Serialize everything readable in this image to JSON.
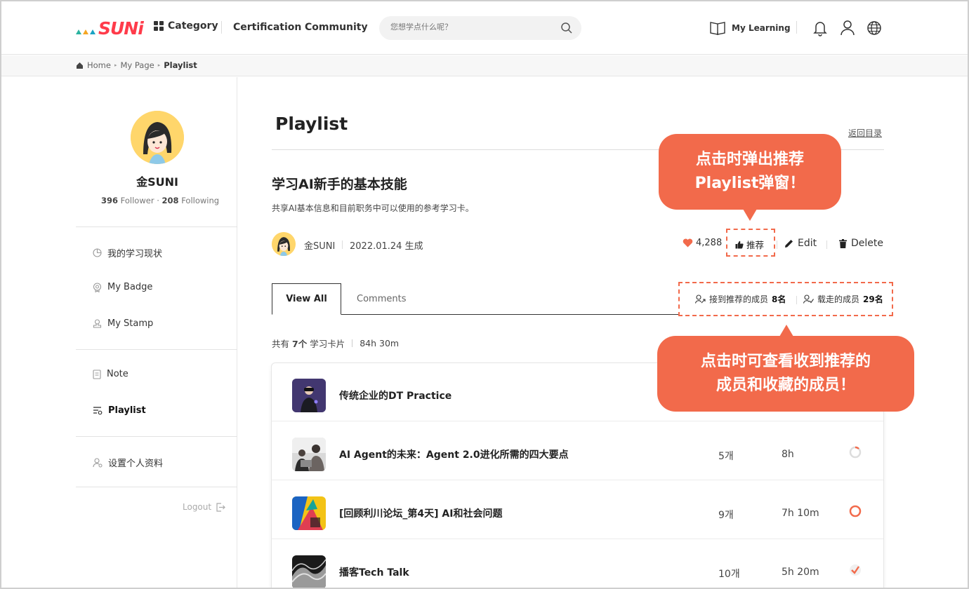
{
  "header": {
    "logo_text": "SUNi",
    "category_label": "Category",
    "certification_label": "Certification",
    "community_label": "Community",
    "search_placeholder": "您想学点什么呢？",
    "my_learning_label": "My Learning",
    "icons": [
      "bell-icon",
      "user-icon",
      "globe-icon"
    ]
  },
  "breadcrumb": {
    "home": "Home",
    "mypage": "My Page",
    "current": "Playlist"
  },
  "profile": {
    "name": "金SUNI",
    "followers": "396",
    "followers_label": "Follower",
    "following": "208",
    "following_label": "Following"
  },
  "sidebar": {
    "items": [
      {
        "label": "我的学习现状",
        "icon": "pie-chart-icon"
      },
      {
        "label": "My Badge",
        "icon": "badge-icon"
      },
      {
        "label": "My Stamp",
        "icon": "stamp-icon"
      },
      {
        "label": "Note",
        "icon": "note-icon"
      },
      {
        "label": "Playlist",
        "icon": "playlist-icon",
        "active": true
      },
      {
        "label": "设置个人资料",
        "icon": "profile-settings-icon"
      }
    ],
    "logout_label": "Logout"
  },
  "main": {
    "page_title": "Playlist",
    "back_link": "返回目录",
    "playlist_title": "学习AI新手的基本技能",
    "playlist_desc": "共享AI基本信息和目前职务中可以使用的参考学习卡。",
    "author": "金SUNI",
    "created": "2022.01.24 生成",
    "likes": "4,288",
    "recommend_label": "推荐",
    "edit_label": "Edit",
    "delete_label": "Delete",
    "tabs": {
      "view_all": "View All",
      "comments": "Comments"
    },
    "received_label": "接到推荐的成员",
    "received_count": "8名",
    "saved_label": "载走的成员",
    "saved_count": "29名",
    "count_prefix": "共有",
    "count_num": "7个",
    "count_suffix": "学习卡片",
    "total_time": "84h 30m"
  },
  "cards": [
    {
      "title": "传统企业的DT Practice",
      "count": "",
      "time": "",
      "status": ""
    },
    {
      "title": "AI Agent的未来：Agent 2.0进化所需的四大要点",
      "count": "5개",
      "time": "8h",
      "status": "partial"
    },
    {
      "title": "[回顾利川论坛_第4天] AI和社会问题",
      "count": "9개",
      "time": "7h 10m",
      "status": "in-progress"
    },
    {
      "title": "播客Tech Talk",
      "count": "10개",
      "time": "5h 20m",
      "status": "done"
    }
  ],
  "callouts": {
    "recommend_note_line1": "点击时弹出推荐",
    "recommend_note_line2": "Playlist弹窗！",
    "members_note_line1": "点击时可查看收到推荐的",
    "members_note_line2": "成员和收藏的成员！"
  },
  "colors": {
    "accent": "#f26a4b",
    "brand_red": "#ff3b4a",
    "brand_teal": "#1aa3c4"
  }
}
